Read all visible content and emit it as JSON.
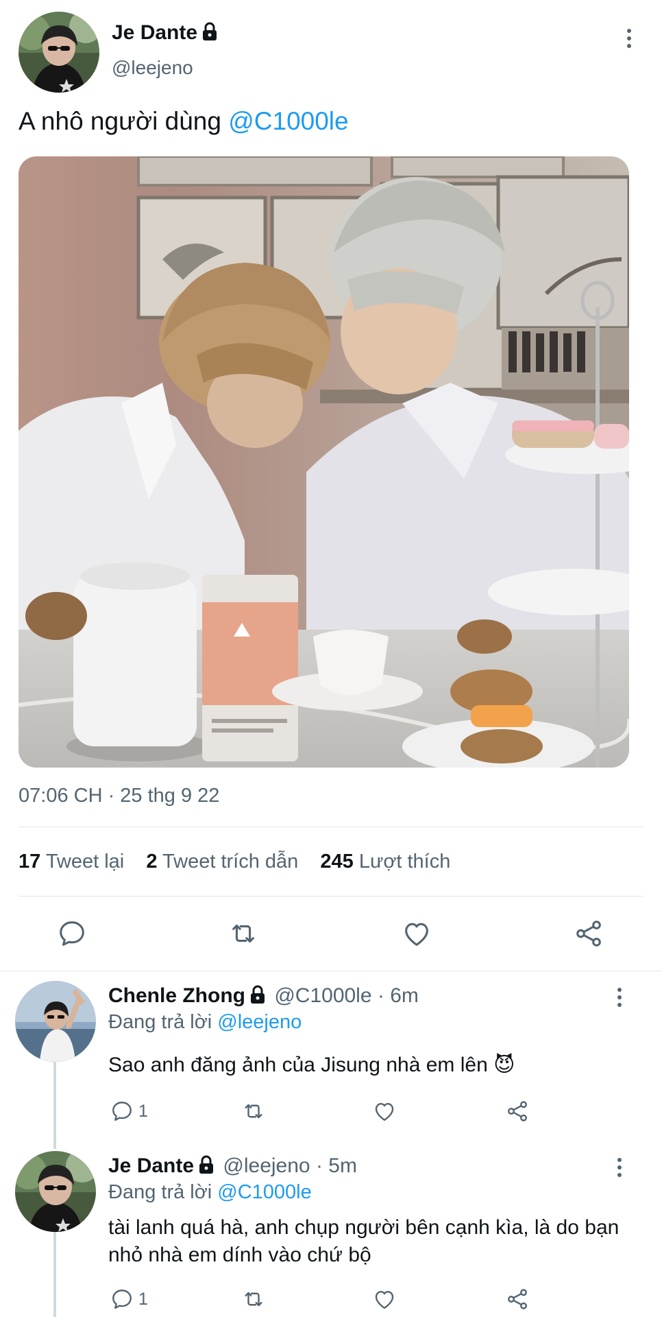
{
  "main_tweet": {
    "author_name": "Je Dante",
    "handle": "@leejeno",
    "text_prefix": "A nhô người dùng ",
    "mention": "@C1000le",
    "timestamp": "07:06 CH · 25 thg 9 22",
    "stats": {
      "retweets_count": "17",
      "retweets_label": "Tweet lại",
      "quotes_count": "2",
      "quotes_label": "Tweet trích dẫn",
      "likes_count": "245",
      "likes_label": "Lượt thích"
    },
    "actions": [
      "reply-icon",
      "retweet-icon",
      "like-icon",
      "share-icon"
    ]
  },
  "replies": [
    {
      "author_name": "Chenle Zhong",
      "handle": "@C1000le",
      "time": "· 6m",
      "replying_label": "Đang trả lời",
      "replying_to": "@leejeno",
      "text": "Sao anh đăng ảnh của Jisung nhà em lên 😈",
      "reply_count": "1"
    },
    {
      "author_name": "Je Dante",
      "handle": "@leejeno",
      "time": "· 5m",
      "replying_label": "Đang trả lời",
      "replying_to": "@C1000le",
      "text": "tài lanh quá hà, anh chụp người bên cạnh kìa, là do bạn nhỏ nhà em dính vào chứ bộ",
      "reply_count": "1"
    }
  ],
  "colors": {
    "link": "#1d9bf0",
    "secondary_text": "#536471",
    "divider": "#e1e6ea"
  }
}
